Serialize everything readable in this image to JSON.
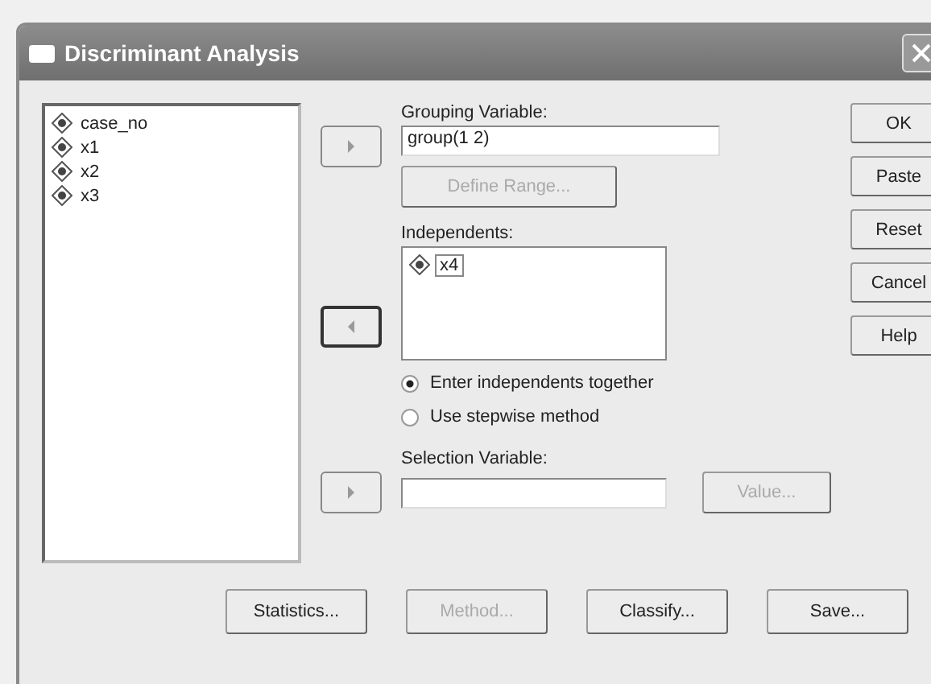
{
  "window": {
    "title": "Discriminant Analysis"
  },
  "variables": [
    {
      "name": "case_no"
    },
    {
      "name": "x1"
    },
    {
      "name": "x2"
    },
    {
      "name": "x3"
    }
  ],
  "grouping": {
    "arrow": {
      "kind": "add",
      "focused": false
    },
    "label": "Grouping Variable:",
    "value": "group(1 2)",
    "define_range": {
      "label": "Define Range...",
      "disabled": true
    }
  },
  "independents": {
    "arrow": {
      "kind": "remove",
      "focused": true
    },
    "label": "Independents:",
    "items": [
      {
        "name": "x4",
        "selected": true
      }
    ]
  },
  "method_options": [
    {
      "label": "Enter independents together",
      "selected": true
    },
    {
      "label": "Use stepwise method",
      "selected": false
    }
  ],
  "selection": {
    "arrow": {
      "kind": "add",
      "focused": false
    },
    "label": "Selection Variable:",
    "value_button": {
      "label": "Value...",
      "disabled": true
    }
  },
  "side_buttons": [
    {
      "label": "OK",
      "disabled": false
    },
    {
      "label": "Paste",
      "disabled": false
    },
    {
      "label": "Reset",
      "disabled": false
    },
    {
      "label": "Cancel",
      "disabled": false
    },
    {
      "label": "Help",
      "disabled": false
    }
  ],
  "bottom_buttons": [
    {
      "label": "Statistics...",
      "disabled": false
    },
    {
      "label": "Method...",
      "disabled": true
    },
    {
      "label": "Classify...",
      "disabled": false
    },
    {
      "label": "Save...",
      "disabled": false
    }
  ]
}
